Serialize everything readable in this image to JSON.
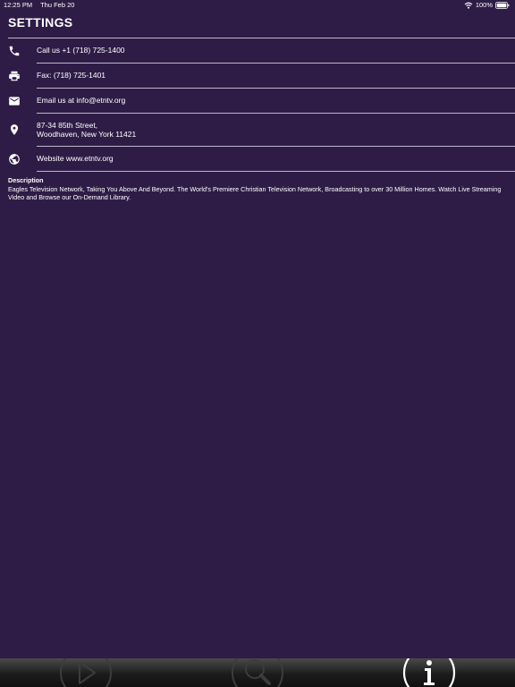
{
  "status_bar": {
    "time": "12:25 PM",
    "date": "Thu Feb 20",
    "battery": "100%"
  },
  "header": {
    "title": "SETTINGS"
  },
  "contact": [
    {
      "icon": "phone-icon",
      "text": "Call us +1 (718) 725-1400"
    },
    {
      "icon": "printer-icon",
      "text": "Fax: (718) 725-1401"
    },
    {
      "icon": "mail-icon",
      "text": "Email us at info@etntv.org"
    },
    {
      "icon": "location-pin-icon",
      "line1": "87-34 85th Street,",
      "line2": "Woodhaven, New York 11421"
    },
    {
      "icon": "globe-icon",
      "text": "Website www.etntv.org"
    }
  ],
  "description": {
    "title": "Description",
    "body": "Eagles Television Network, Taking You Above And Beyond. The World's Premiere Christian Television Network, Broadcasting to over 30 Million Homes. Watch Live Streaming Video and Browse our On-Demand Library."
  },
  "tab_bar": {
    "tabs": [
      {
        "icon": "play-icon"
      },
      {
        "icon": "search-icon"
      },
      {
        "icon": "info-icon"
      }
    ]
  }
}
